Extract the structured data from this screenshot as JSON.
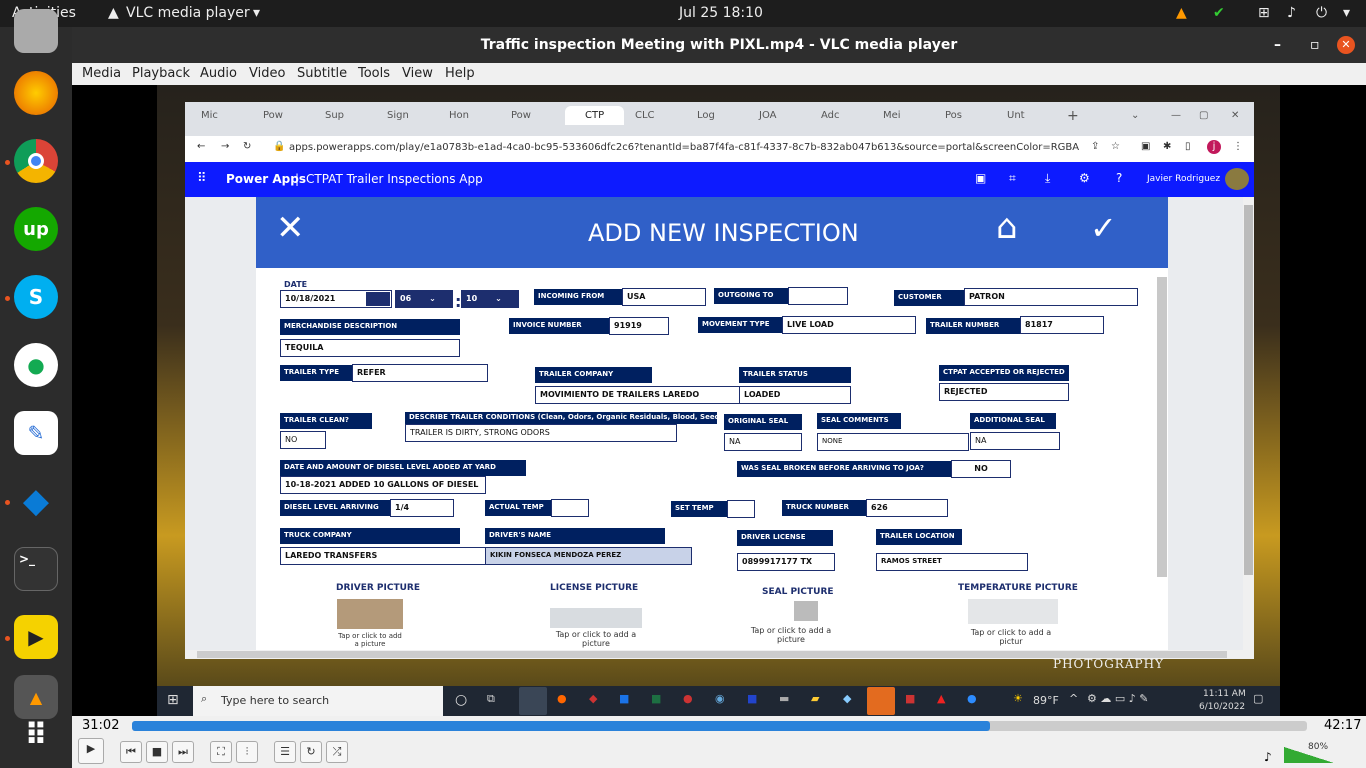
{
  "topbar": {
    "activities": "Activities",
    "app": "VLC media player",
    "clock": "Jul 25  18:10"
  },
  "vlc": {
    "title": "Traffic inspection Meeting with PIXL.mp4 - VLC media player",
    "menu": [
      "Media",
      "Playback",
      "Audio",
      "Video",
      "Subtitle",
      "Tools",
      "View",
      "Help"
    ],
    "time_elapsed": "31:02",
    "time_total": "42:17",
    "volume": "80%",
    "progress": 0.73
  },
  "browser": {
    "tabs": [
      "Mic",
      "Pow",
      "Sup",
      "Sign",
      "Hon",
      "Pow",
      "CTP",
      "CLC",
      "Log",
      "JOA",
      "Adc",
      "Mei",
      "Pos",
      "Unt"
    ],
    "url": "apps.powerapps.com/play/e1a0783b-e1ad-4ca0-bc95-533606dfc2c6?tenantId=ba87f4fa-c81f-4337-8c7b-832ab047b613&source=portal&screenColor=RGBA(0%2C176%2C..."
  },
  "powerapps": {
    "brand": "Power Apps",
    "app_name": "CTPAT Trailer Inspections App",
    "user": "Javier Rodriguez"
  },
  "form": {
    "title": "ADD NEW INSPECTION",
    "date_label": "DATE",
    "date": "10/18/2021",
    "hour": "06",
    "minute": "10",
    "incoming_from_label": "INCOMING FROM",
    "incoming_from": "USA",
    "outgoing_to_label": "OUTGOING TO",
    "outgoing_to": "",
    "customer_label": "CUSTOMER",
    "customer": "PATRON",
    "merch_label": "MERCHANDISE DESCRIPTION",
    "merch": "TEQUILA",
    "invoice_label": "INVOICE NUMBER",
    "invoice": "91919",
    "movement_label": "MOVEMENT TYPE",
    "movement": "LIVE LOAD",
    "trailer_number_label": "TRAILER NUMBER",
    "trailer_number": "81817",
    "trailer_type_label": "TRAILER TYPE",
    "trailer_type": "REFER",
    "trailer_company_label": "TRAILER COMPANY",
    "trailer_company": "MOVIMIENTO DE TRAILERS LAREDO",
    "trailer_status_label": "TRAILER STATUS",
    "trailer_status": "LOADED",
    "ctpat_label": "CTPAT ACCEPTED OR REJECTED",
    "ctpat": "REJECTED",
    "trailer_clean_label": "TRAILER CLEAN?",
    "trailer_clean": "NO",
    "conditions_label": "DESCRIBE TRAILER CONDITIONS (Clean, Odors, Organic Residuals, Blood, Seeds, Dirty)",
    "conditions": "TRAILER IS DIRTY, STRONG ODORS",
    "original_seal_label": "ORIGINAL SEAL",
    "original_seal": "NA",
    "seal_comments_label": "SEAL COMMENTS",
    "seal_comments": "NONE",
    "additional_seal_label": "ADDITIONAL SEAL",
    "additional_seal": "NA",
    "diesel_label": "DATE AND AMOUNT OF DIESEL LEVEL ADDED AT YARD",
    "diesel": "10-18-2021 ADDED 10 GALLONS OF DIESEL",
    "seal_broken_label": "WAS SEAL BROKEN BEFORE ARRIVING TO JOA?",
    "seal_broken": "NO",
    "diesel_arriving_label": "DIESEL LEVEL ARRIVING",
    "diesel_arriving": "1/4",
    "actual_temp_label": "ACTUAL TEMP",
    "actual_temp": "",
    "set_temp_label": "SET TEMP",
    "set_temp": "",
    "truck_number_label": "TRUCK NUMBER",
    "truck_number": "626",
    "truck_company_label": "TRUCK COMPANY",
    "truck_company": "LAREDO TRANSFERS",
    "driver_name_label": "DRIVER'S NAME",
    "driver_name": "KIKIN FONSECA MENDOZA PEREZ",
    "driver_license_label": "DRIVER LICENSE",
    "driver_license": "0899917177 TX",
    "trailer_location_label": "TRAILER LOCATION",
    "trailer_location": "RAMOS STREET",
    "pictures": [
      {
        "label": "DRIVER PICTURE",
        "sub": "Tap or click to add a picture"
      },
      {
        "label": "LICENSE PICTURE",
        "sub": "Tap or click to add a picture"
      },
      {
        "label": "SEAL PICTURE",
        "sub": "Tap or click to add a picture"
      },
      {
        "label": "TEMPERATURE PICTURE",
        "sub": "Tap or click to add a pictur"
      }
    ]
  },
  "win_taskbar": {
    "search": "Type here to search",
    "weather": "89°F",
    "time": "11:11 AM",
    "date": "6/10/2022"
  },
  "watermark": "PHOTOGRAPHY"
}
